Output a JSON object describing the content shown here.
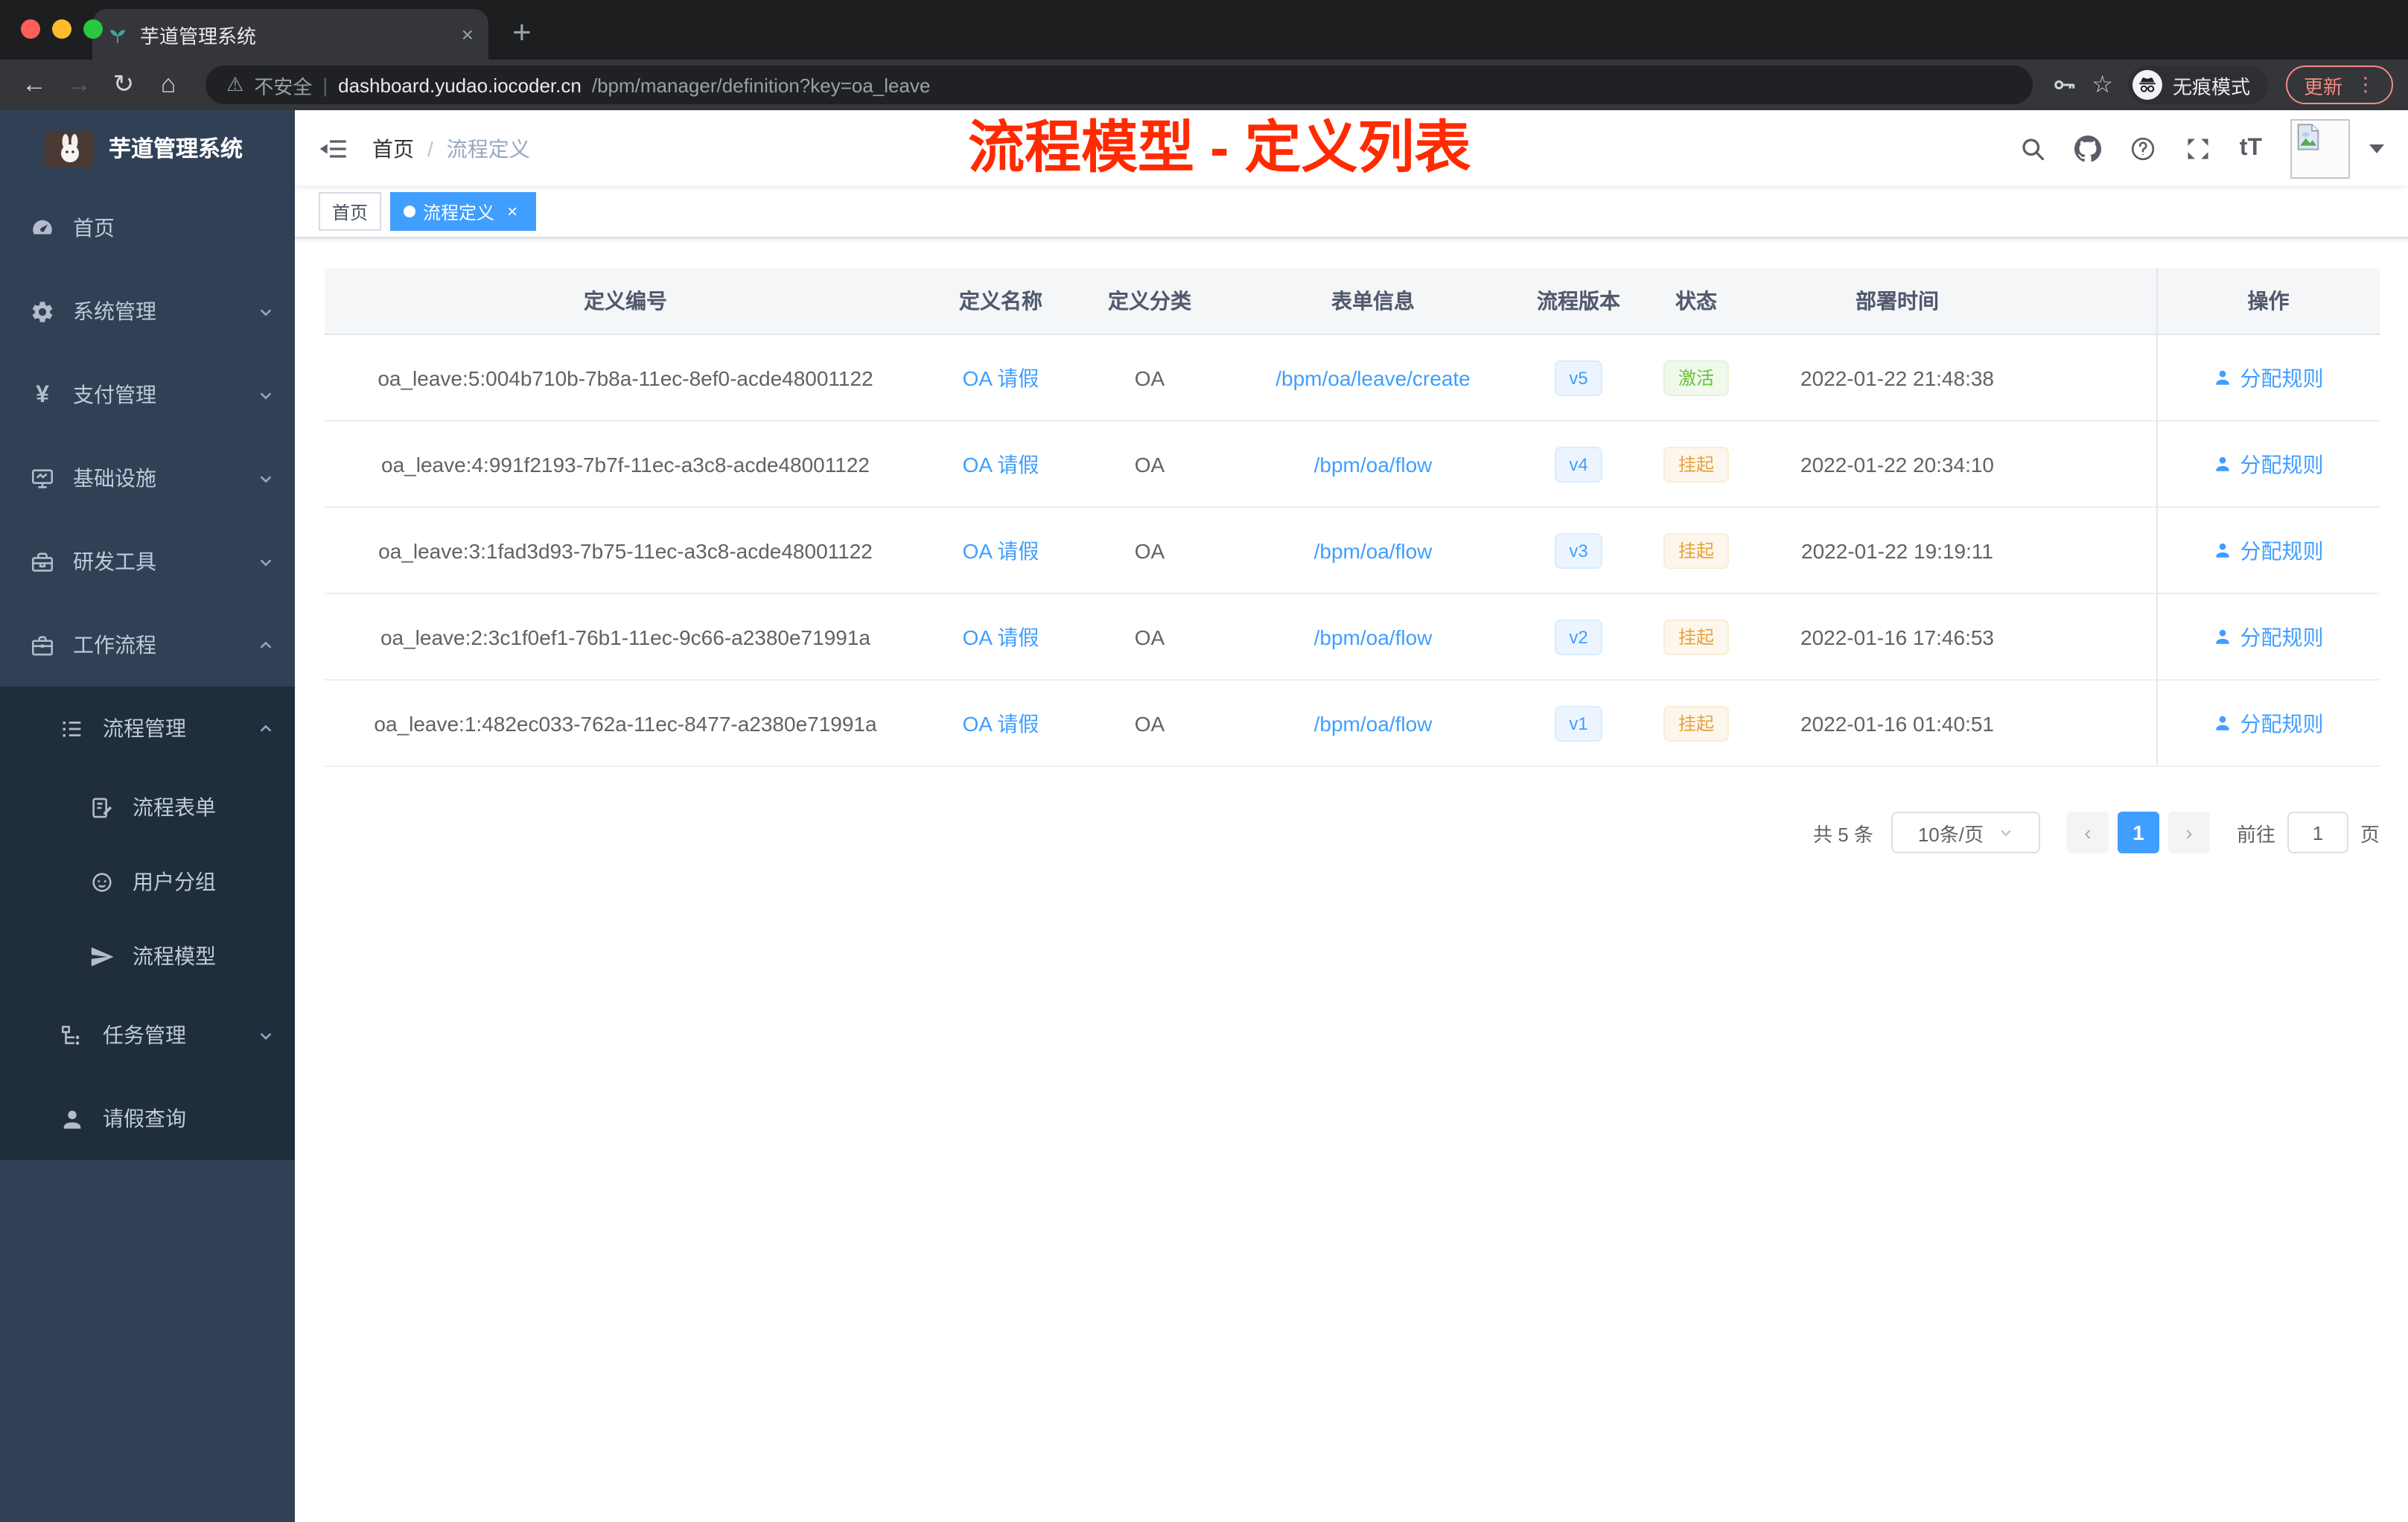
{
  "browser": {
    "tab_title": "芋道管理系统",
    "close_tab": "×",
    "new_tab": "+",
    "back": "←",
    "forward": "→",
    "reload": "↻",
    "home_btn": "⌂",
    "security_warn": "⚠",
    "security_label": "不安全",
    "url_host": "dashboard.yudao.iocoder.cn",
    "url_path": "/bpm/manager/definition?key=oa_leave",
    "star": "☆",
    "incognito_label": "无痕模式",
    "update_label": "更新",
    "kebab": "⋮"
  },
  "sidebar": {
    "logo_title": "芋道管理系统",
    "items": {
      "home": "首页",
      "system": "系统管理",
      "pay": "支付管理",
      "infra": "基础设施",
      "dev": "研发工具",
      "workflow": "工作流程",
      "process": "流程管理",
      "form": "流程表单",
      "group": "用户分组",
      "model": "流程模型",
      "task": "任务管理",
      "leave": "请假查询"
    }
  },
  "header": {
    "breadcrumb_home": "首页",
    "breadcrumb_sep": "/",
    "breadcrumb_current": "流程定义",
    "annotation": "流程模型 - 定义列表",
    "tt_icon": "tT"
  },
  "tags": {
    "home": "首页",
    "current": "流程定义",
    "close": "×"
  },
  "table": {
    "columns": {
      "id": "定义编号",
      "name": "定义名称",
      "category": "定义分类",
      "form": "表单信息",
      "version": "流程版本",
      "status": "状态",
      "deploy_time": "部署时间",
      "actions": "操作"
    },
    "rows": [
      {
        "id": "oa_leave:5:004b710b-7b8a-11ec-8ef0-acde48001122",
        "name": "OA 请假",
        "category": "OA",
        "form": "/bpm/oa/leave/create",
        "version": "v5",
        "status": "激活",
        "deploy_time": "2022-01-22 21:48:38",
        "action": "分配规则"
      },
      {
        "id": "oa_leave:4:991f2193-7b7f-11ec-a3c8-acde48001122",
        "name": "OA 请假",
        "category": "OA",
        "form": "/bpm/oa/flow",
        "version": "v4",
        "status": "挂起",
        "deploy_time": "2022-01-22 20:34:10",
        "action": "分配规则"
      },
      {
        "id": "oa_leave:3:1fad3d93-7b75-11ec-a3c8-acde48001122",
        "name": "OA 请假",
        "category": "OA",
        "form": "/bpm/oa/flow",
        "version": "v3",
        "status": "挂起",
        "deploy_time": "2022-01-22 19:19:11",
        "action": "分配规则"
      },
      {
        "id": "oa_leave:2:3c1f0ef1-76b1-11ec-9c66-a2380e71991a",
        "name": "OA 请假",
        "category": "OA",
        "form": "/bpm/oa/flow",
        "version": "v2",
        "status": "挂起",
        "deploy_time": "2022-01-16 17:46:53",
        "action": "分配规则"
      },
      {
        "id": "oa_leave:1:482ec033-762a-11ec-8477-a2380e71991a",
        "name": "OA 请假",
        "category": "OA",
        "form": "/bpm/oa/flow",
        "version": "v1",
        "status": "挂起",
        "deploy_time": "2022-01-16 01:40:51",
        "action": "分配规则"
      }
    ]
  },
  "pagination": {
    "total": "共 5 条",
    "page_size": "10条/页",
    "prev": "‹",
    "page": "1",
    "next": "›",
    "goto_label": "前往",
    "goto_value": "1",
    "page_unit": "页"
  },
  "colors": {
    "accent": "#409eff",
    "success": "#67c23a",
    "warning": "#e6a23c",
    "annotation_red": "#ff2a00",
    "sidebar_bg": "#304156",
    "submenu_bg": "#1f2d3d"
  }
}
